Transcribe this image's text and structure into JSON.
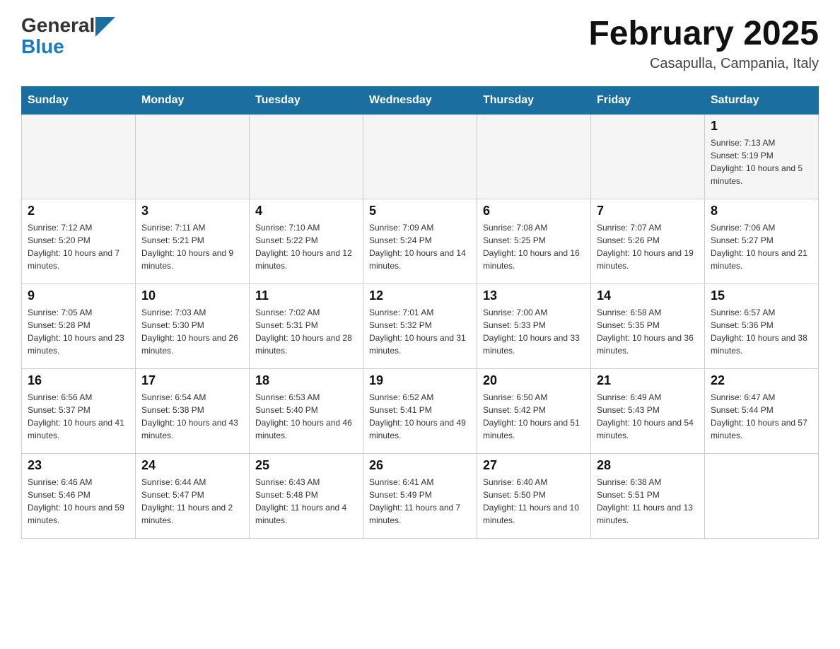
{
  "header": {
    "logo_general": "General",
    "logo_blue": "Blue",
    "title": "February 2025",
    "subtitle": "Casapulla, Campania, Italy"
  },
  "weekdays": [
    "Sunday",
    "Monday",
    "Tuesday",
    "Wednesday",
    "Thursday",
    "Friday",
    "Saturday"
  ],
  "weeks": [
    [
      {
        "day": "",
        "info": ""
      },
      {
        "day": "",
        "info": ""
      },
      {
        "day": "",
        "info": ""
      },
      {
        "day": "",
        "info": ""
      },
      {
        "day": "",
        "info": ""
      },
      {
        "day": "",
        "info": ""
      },
      {
        "day": "1",
        "info": "Sunrise: 7:13 AM\nSunset: 5:19 PM\nDaylight: 10 hours and 5 minutes."
      }
    ],
    [
      {
        "day": "2",
        "info": "Sunrise: 7:12 AM\nSunset: 5:20 PM\nDaylight: 10 hours and 7 minutes."
      },
      {
        "day": "3",
        "info": "Sunrise: 7:11 AM\nSunset: 5:21 PM\nDaylight: 10 hours and 9 minutes."
      },
      {
        "day": "4",
        "info": "Sunrise: 7:10 AM\nSunset: 5:22 PM\nDaylight: 10 hours and 12 minutes."
      },
      {
        "day": "5",
        "info": "Sunrise: 7:09 AM\nSunset: 5:24 PM\nDaylight: 10 hours and 14 minutes."
      },
      {
        "day": "6",
        "info": "Sunrise: 7:08 AM\nSunset: 5:25 PM\nDaylight: 10 hours and 16 minutes."
      },
      {
        "day": "7",
        "info": "Sunrise: 7:07 AM\nSunset: 5:26 PM\nDaylight: 10 hours and 19 minutes."
      },
      {
        "day": "8",
        "info": "Sunrise: 7:06 AM\nSunset: 5:27 PM\nDaylight: 10 hours and 21 minutes."
      }
    ],
    [
      {
        "day": "9",
        "info": "Sunrise: 7:05 AM\nSunset: 5:28 PM\nDaylight: 10 hours and 23 minutes."
      },
      {
        "day": "10",
        "info": "Sunrise: 7:03 AM\nSunset: 5:30 PM\nDaylight: 10 hours and 26 minutes."
      },
      {
        "day": "11",
        "info": "Sunrise: 7:02 AM\nSunset: 5:31 PM\nDaylight: 10 hours and 28 minutes."
      },
      {
        "day": "12",
        "info": "Sunrise: 7:01 AM\nSunset: 5:32 PM\nDaylight: 10 hours and 31 minutes."
      },
      {
        "day": "13",
        "info": "Sunrise: 7:00 AM\nSunset: 5:33 PM\nDaylight: 10 hours and 33 minutes."
      },
      {
        "day": "14",
        "info": "Sunrise: 6:58 AM\nSunset: 5:35 PM\nDaylight: 10 hours and 36 minutes."
      },
      {
        "day": "15",
        "info": "Sunrise: 6:57 AM\nSunset: 5:36 PM\nDaylight: 10 hours and 38 minutes."
      }
    ],
    [
      {
        "day": "16",
        "info": "Sunrise: 6:56 AM\nSunset: 5:37 PM\nDaylight: 10 hours and 41 minutes."
      },
      {
        "day": "17",
        "info": "Sunrise: 6:54 AM\nSunset: 5:38 PM\nDaylight: 10 hours and 43 minutes."
      },
      {
        "day": "18",
        "info": "Sunrise: 6:53 AM\nSunset: 5:40 PM\nDaylight: 10 hours and 46 minutes."
      },
      {
        "day": "19",
        "info": "Sunrise: 6:52 AM\nSunset: 5:41 PM\nDaylight: 10 hours and 49 minutes."
      },
      {
        "day": "20",
        "info": "Sunrise: 6:50 AM\nSunset: 5:42 PM\nDaylight: 10 hours and 51 minutes."
      },
      {
        "day": "21",
        "info": "Sunrise: 6:49 AM\nSunset: 5:43 PM\nDaylight: 10 hours and 54 minutes."
      },
      {
        "day": "22",
        "info": "Sunrise: 6:47 AM\nSunset: 5:44 PM\nDaylight: 10 hours and 57 minutes."
      }
    ],
    [
      {
        "day": "23",
        "info": "Sunrise: 6:46 AM\nSunset: 5:46 PM\nDaylight: 10 hours and 59 minutes."
      },
      {
        "day": "24",
        "info": "Sunrise: 6:44 AM\nSunset: 5:47 PM\nDaylight: 11 hours and 2 minutes."
      },
      {
        "day": "25",
        "info": "Sunrise: 6:43 AM\nSunset: 5:48 PM\nDaylight: 11 hours and 4 minutes."
      },
      {
        "day": "26",
        "info": "Sunrise: 6:41 AM\nSunset: 5:49 PM\nDaylight: 11 hours and 7 minutes."
      },
      {
        "day": "27",
        "info": "Sunrise: 6:40 AM\nSunset: 5:50 PM\nDaylight: 11 hours and 10 minutes."
      },
      {
        "day": "28",
        "info": "Sunrise: 6:38 AM\nSunset: 5:51 PM\nDaylight: 11 hours and 13 minutes."
      },
      {
        "day": "",
        "info": ""
      }
    ]
  ]
}
